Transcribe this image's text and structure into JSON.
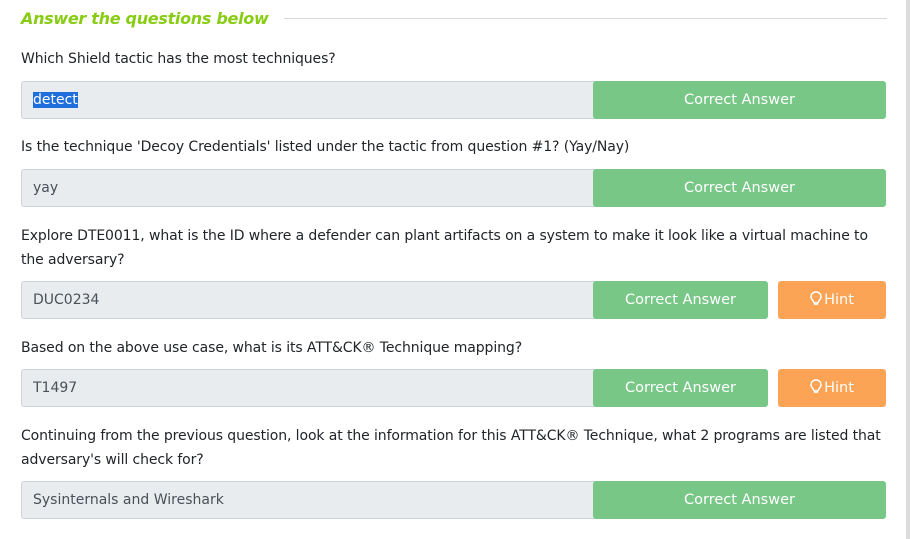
{
  "section": {
    "title": "Answer the questions below"
  },
  "questions": [
    {
      "text": "Which Shield tactic has the most techniques?",
      "answer": "detect",
      "correct_label": "Correct Answer"
    },
    {
      "text": "Is the technique 'Decoy Credentials' listed under the tactic from question #1? (Yay/Nay)",
      "answer": "yay",
      "correct_label": "Correct Answer"
    },
    {
      "text": "Explore DTE0011, what is the ID where a defender can plant artifacts on a system to make it look like a virtual machine to the adversary?",
      "answer": "DUC0234",
      "correct_label": "Correct Answer",
      "hint_label": "Hint"
    },
    {
      "text": "Based on the above use case, what is its ATT&CK® Technique mapping?",
      "answer": "T1497",
      "correct_label": "Correct Answer",
      "hint_label": "Hint"
    },
    {
      "text": "Continuing from the previous question, look at the information for this ATT&CK® Technique, what 2 programs are listed that adversary's will check for?",
      "answer": "Sysinternals and Wireshark",
      "correct_label": "Correct Answer"
    }
  ],
  "colors": {
    "accent": "#88cc14",
    "correct": "#78c787",
    "hint": "#fba456",
    "input_bg": "#e9ecef",
    "selection": "#1e6fdc"
  },
  "icons": {
    "hint": "lightbulb-icon"
  }
}
